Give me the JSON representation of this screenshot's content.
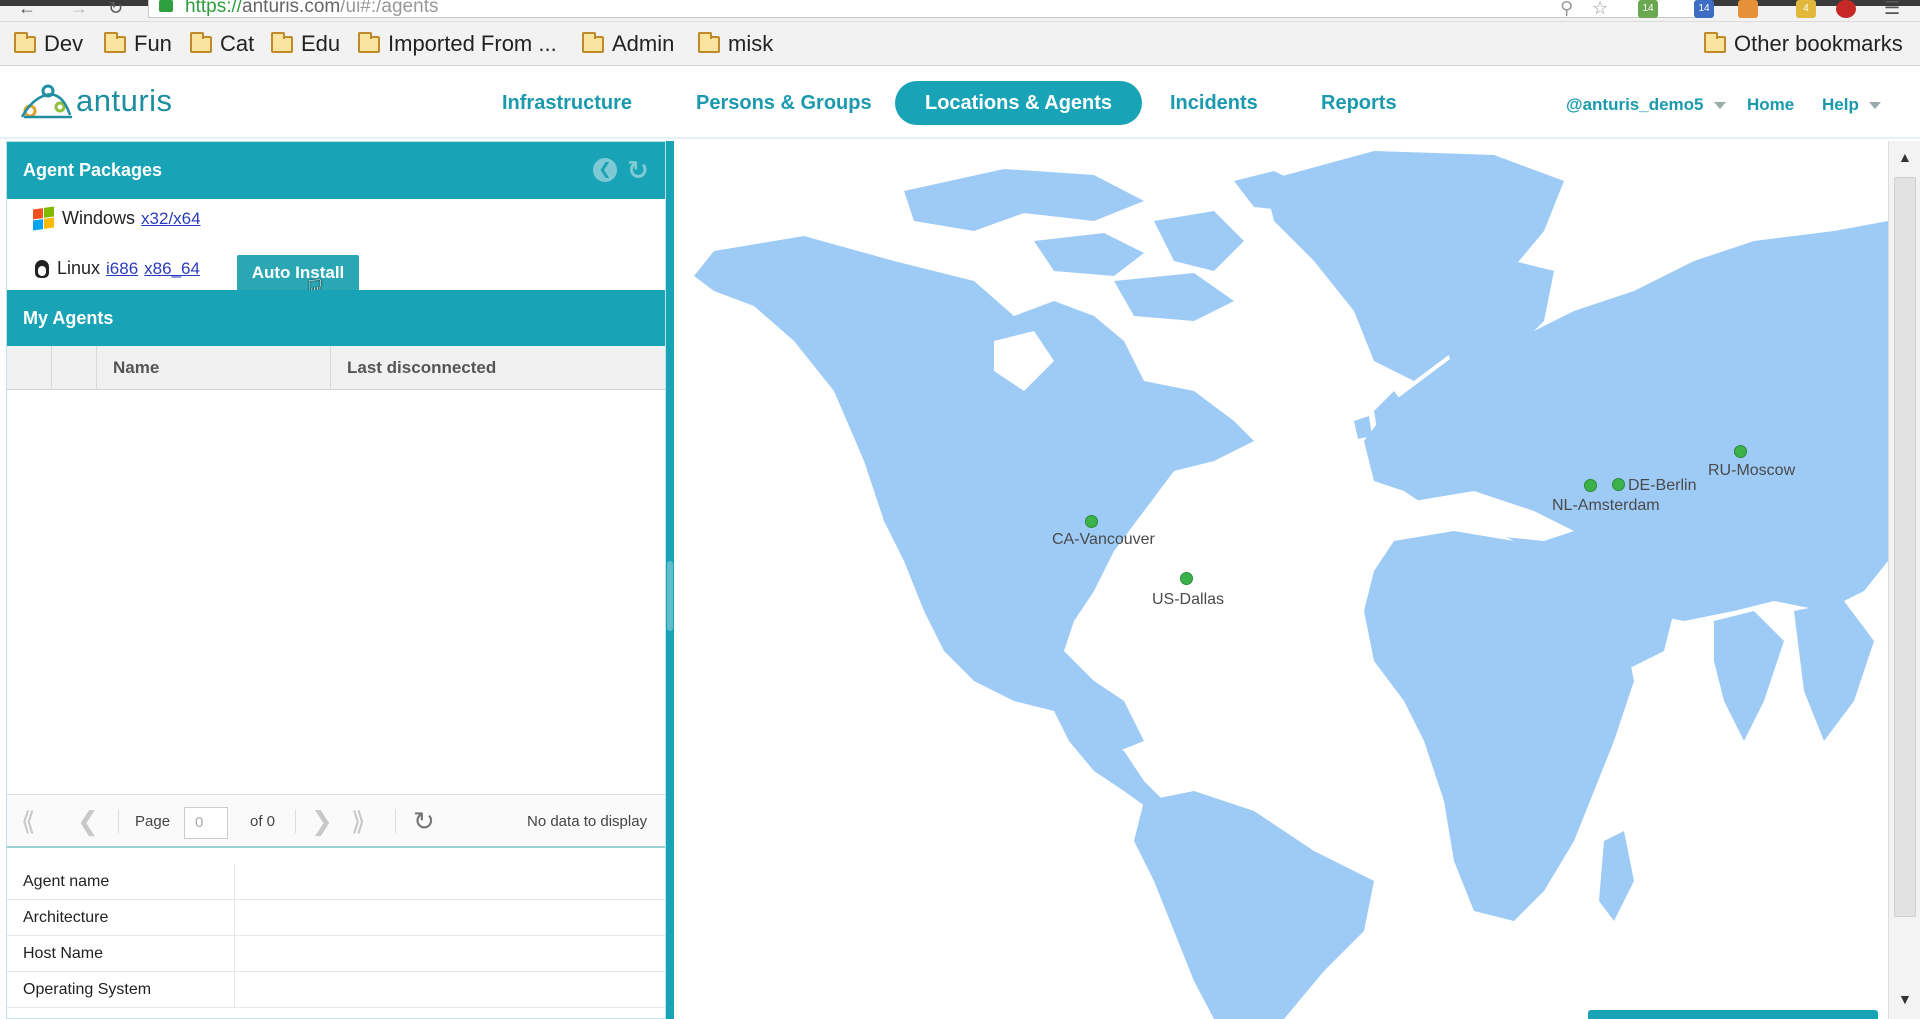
{
  "browser": {
    "url_scheme": "https://",
    "url_host": "anturis.com",
    "url_path": "/ui#:/agents",
    "bookmarks": [
      "Dev",
      "Fun",
      "Cat",
      "Edu",
      "Imported From ...",
      "Admin",
      "misk"
    ],
    "other_bookmarks": "Other bookmarks",
    "ext_badges": [
      "14",
      "14",
      "4"
    ]
  },
  "header": {
    "logo_text": "anturis",
    "nav": [
      "Infrastructure",
      "Persons & Groups",
      "Locations & Agents",
      "Incidents",
      "Reports"
    ],
    "active_nav": "Locations & Agents",
    "user": "@anturis_demo5",
    "home": "Home",
    "help": "Help"
  },
  "agent_packages": {
    "title": "Agent Packages",
    "windows_label": "Windows",
    "windows_link": "x32/x64",
    "linux_label": "Linux",
    "linux_link_1": "i686",
    "linux_link_2": "x86_64",
    "auto_install": "Auto Install"
  },
  "my_agents": {
    "title": "My Agents",
    "col_name": "Name",
    "col_last": "Last disconnected",
    "pager_page": "Page",
    "pager_value": "0",
    "pager_of": "of 0",
    "pager_status": "No data to display"
  },
  "properties": [
    "Agent name",
    "Architecture",
    "Host Name",
    "Operating System"
  ],
  "locations": [
    "CA-Vancouver",
    "US-Dallas",
    "NL-Amsterdam",
    "DE-Berlin",
    "RU-Moscow"
  ],
  "colors": {
    "accent": "#18a3b6",
    "map_land": "#9ecbf6",
    "marker": "#3cb34a"
  }
}
